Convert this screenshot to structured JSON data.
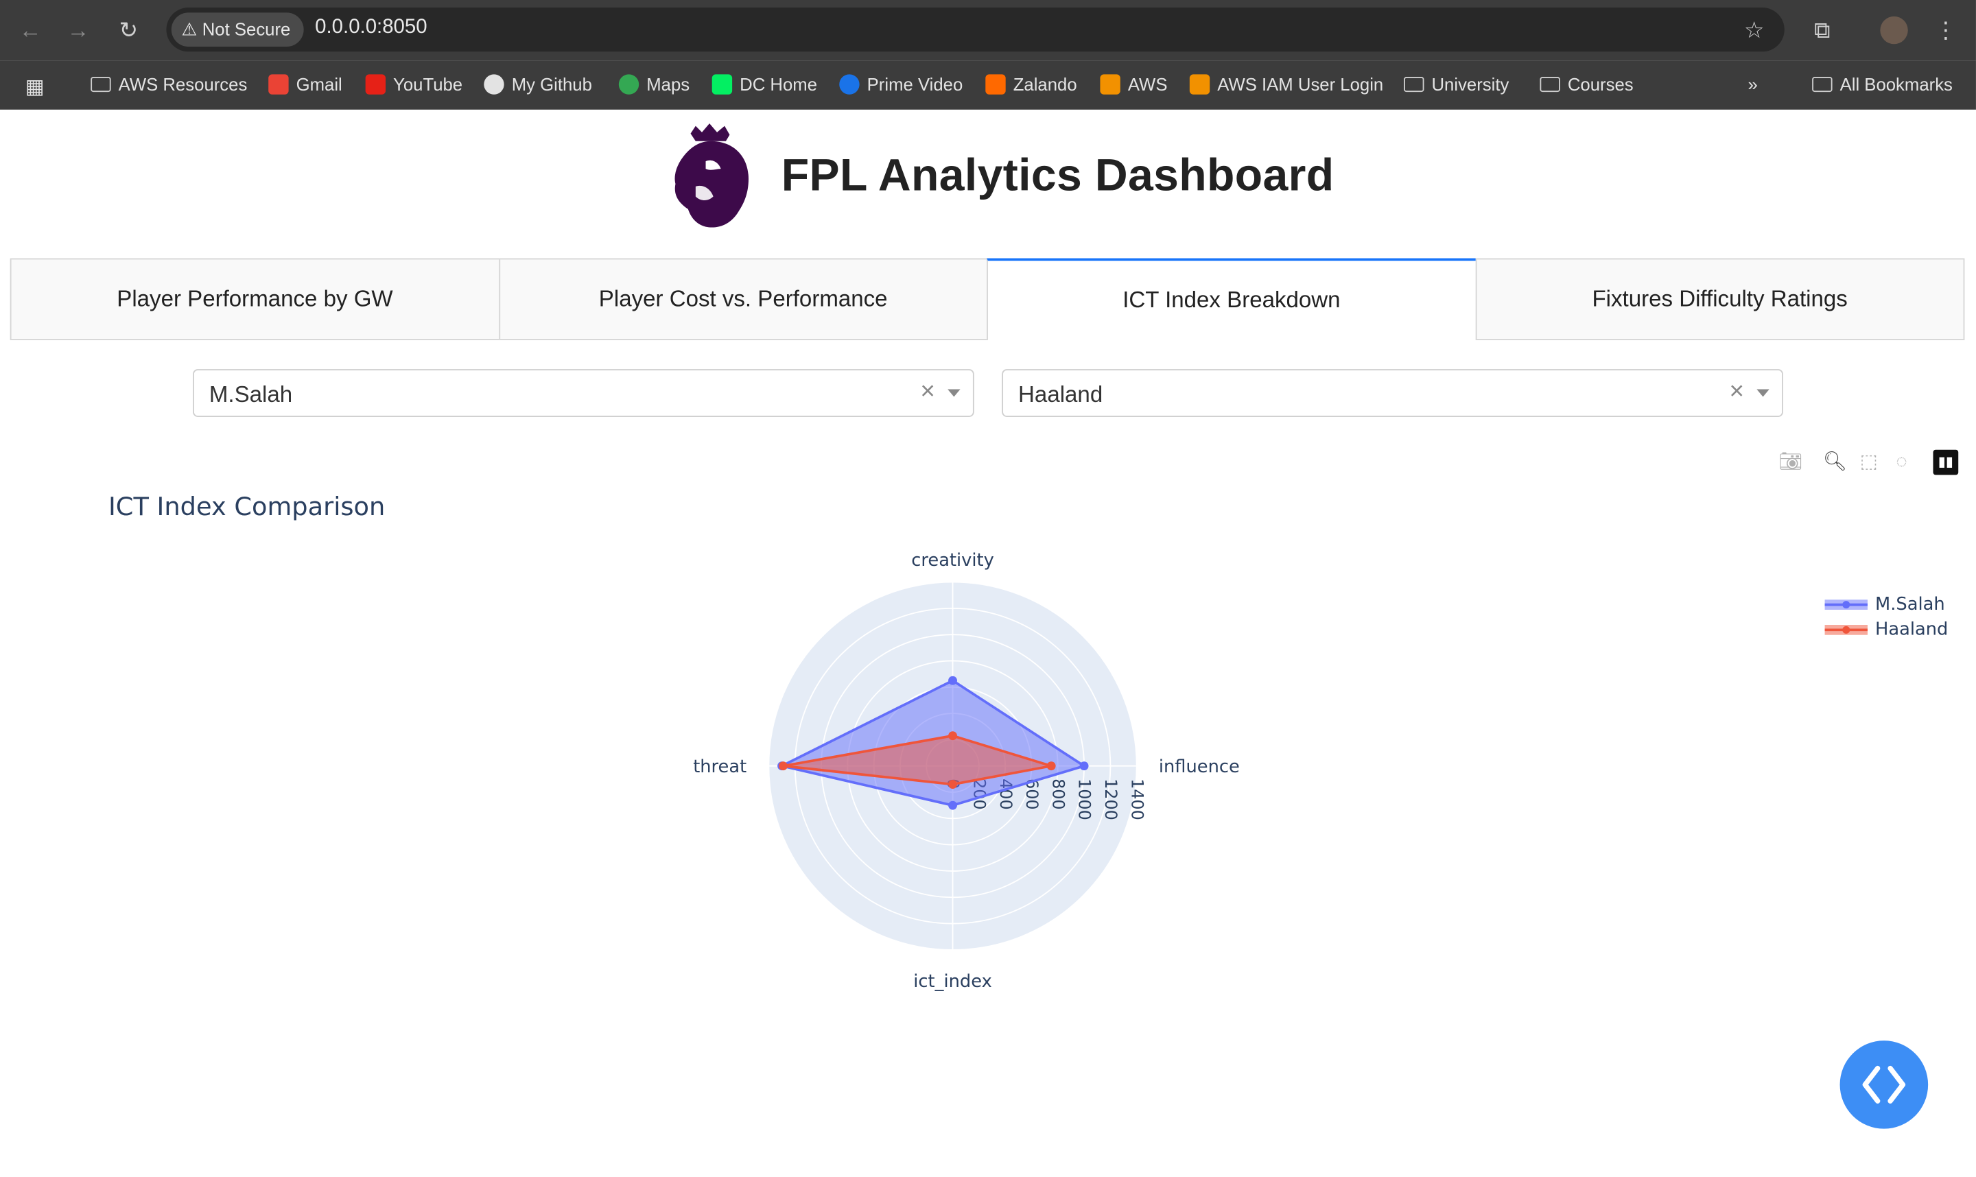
{
  "browser": {
    "security_label": "Not Secure",
    "url": "0.0.0.0:8050",
    "bookmarks": [
      {
        "label": "AWS Resources",
        "icon": "folder-icon"
      },
      {
        "label": "Gmail",
        "icon": "gmail-icon"
      },
      {
        "label": "YouTube",
        "icon": "youtube-icon"
      },
      {
        "label": "My Github",
        "icon": "github-icon"
      },
      {
        "label": "Maps",
        "icon": "maps-icon"
      },
      {
        "label": "DC Home",
        "icon": "datacamp-icon"
      },
      {
        "label": "Prime Video",
        "icon": "prime-video-icon"
      },
      {
        "label": "Zalando",
        "icon": "zalando-icon"
      },
      {
        "label": "AWS",
        "icon": "aws-icon"
      },
      {
        "label": "AWS IAM User Login",
        "icon": "aws-icon"
      },
      {
        "label": "University",
        "icon": "folder-icon"
      },
      {
        "label": "Courses",
        "icon": "folder-icon"
      }
    ],
    "all_bookmarks": "All Bookmarks",
    "overflow": "»"
  },
  "page": {
    "title": "FPL Analytics Dashboard",
    "tabs": [
      {
        "label": "Player Performance by GW",
        "active": false
      },
      {
        "label": "Player Cost vs. Performance",
        "active": false
      },
      {
        "label": "ICT Index Breakdown",
        "active": true
      },
      {
        "label": "Fixtures Difficulty Ratings",
        "active": false
      }
    ],
    "dropdowns": [
      {
        "value": "M.Salah",
        "clear": "×"
      },
      {
        "value": "Haaland",
        "clear": "×"
      }
    ]
  },
  "colors": {
    "salah": "#636efa",
    "haaland": "#ef553b",
    "polar_bg": "#e5ecf6",
    "active_tab": "#1975fa",
    "code_button": "#3d8ef5"
  },
  "chart_data": {
    "type": "radar",
    "title": "ICT Index Comparison",
    "axes": [
      "influence",
      "creativity",
      "threat",
      "ict_index"
    ],
    "radial_ticks": [
      0,
      200,
      400,
      600,
      800,
      1000,
      1200,
      1400
    ],
    "radial_range": [
      0,
      1400
    ],
    "series": [
      {
        "name": "M.Salah",
        "values": [
          1000,
          650,
          1300,
          300
        ]
      },
      {
        "name": "Haaland",
        "values": [
          750,
          230,
          1290,
          140
        ]
      }
    ],
    "legend_position": "top-right"
  }
}
